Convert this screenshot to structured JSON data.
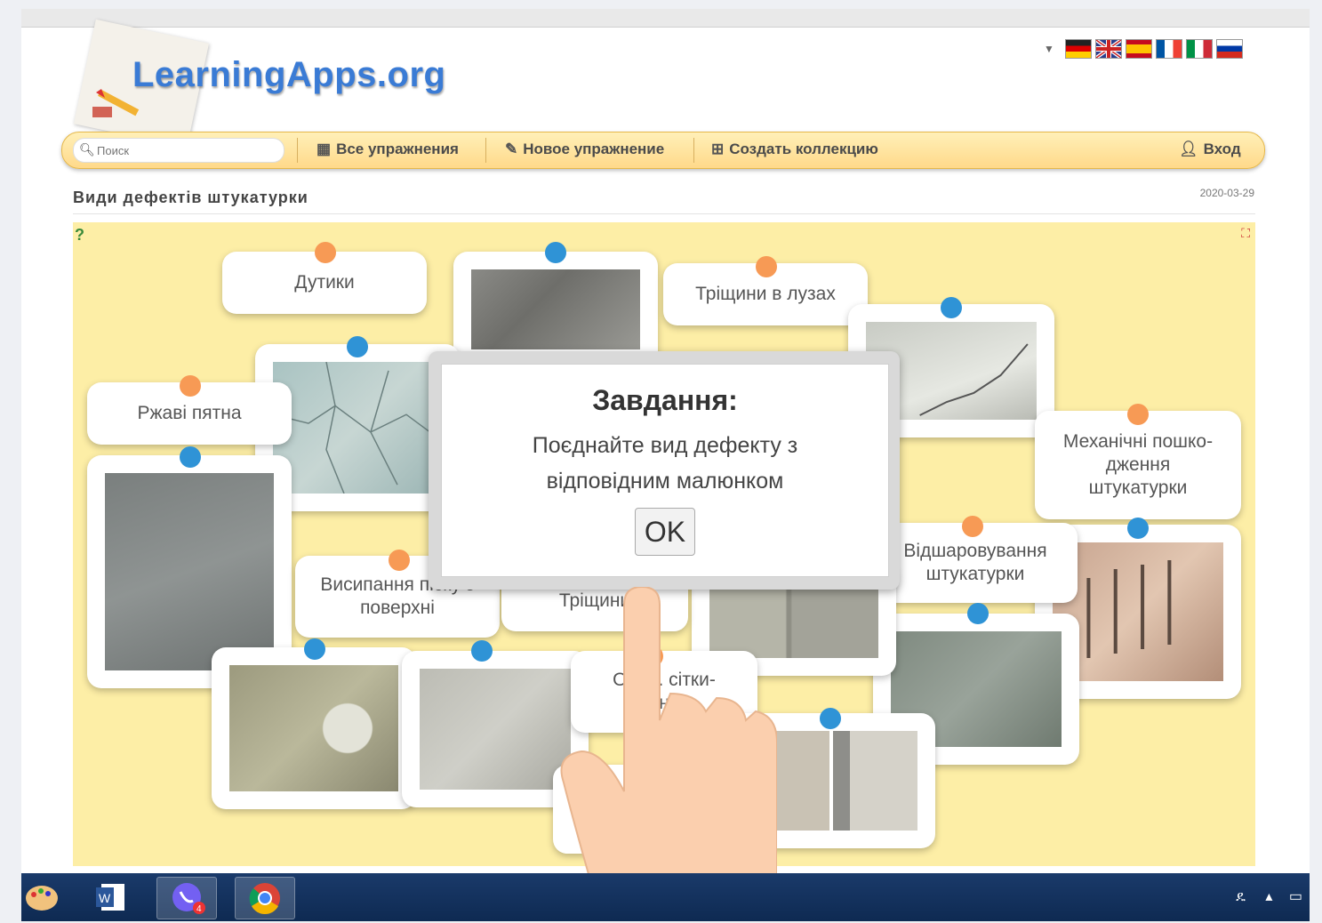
{
  "brand": {
    "logo_text": "LearningApps.org"
  },
  "languages": [
    "de",
    "gb",
    "es",
    "fr",
    "it",
    "ru"
  ],
  "nav": {
    "search_placeholder": "Поиск",
    "all_exercises": "Все упражнения",
    "new_exercise": "Новое упражнение",
    "create_collection": "Создать коллекцию",
    "login": "Вход"
  },
  "exercise": {
    "title": "Види дефектів штукатурки",
    "date": "2020-03-29"
  },
  "cards": {
    "dutyky": "Дутики",
    "trishchyny_luzakh": "Тріщини в лузах",
    "rzhavi_plyamy": "Ржаві пятна",
    "mekhanichni_line1": "Механічні пошко-",
    "mekhanichni_line2": "дження",
    "mekhanichni_line3": "штукатурки",
    "vidsharovuvannya_line1": "Відшаровування",
    "vidsharovuvannya_line2": "штукатурки",
    "vysypannya_line1": "Висипання піску з",
    "vysypannya_line2": "поверхні",
    "trishchyny": "Тріщини",
    "partial_line1": "Обл... сітки-",
    "partial_line2": "ння"
  },
  "modal": {
    "title": "Завдання:",
    "line1": "Поєднайте вид дефекту з",
    "line2": "відповідним малюнком",
    "ok": "OK"
  },
  "colors": {
    "canvas_bg": "#fdeea6",
    "orange_dot": "#f79a55",
    "blue_dot": "#2f93d6",
    "brand_blue": "#3a7bd5"
  },
  "taskbar": {
    "apps": [
      "paint-icon",
      "word-icon",
      "viber-icon",
      "chrome-icon"
    ],
    "viber_badge": "4"
  }
}
